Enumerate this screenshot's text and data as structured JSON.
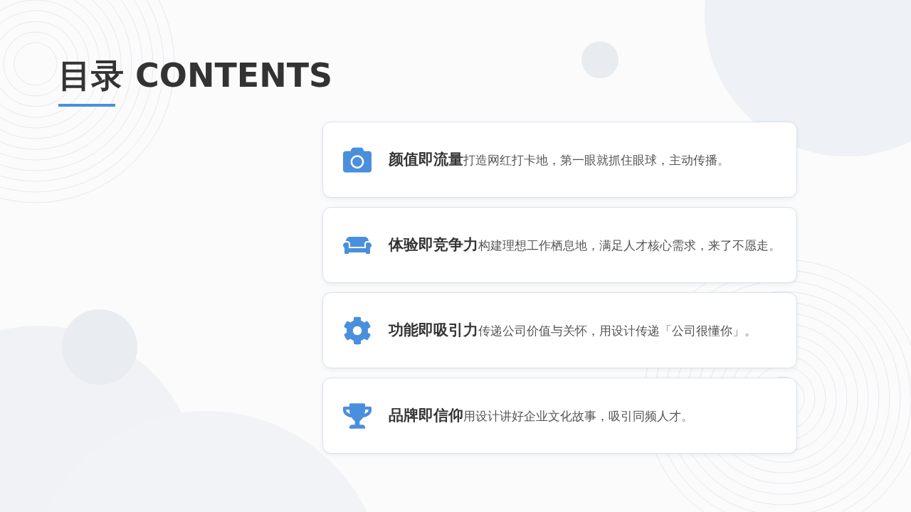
{
  "title": "目录 CONTENTS",
  "items": [
    {
      "kind": "camera",
      "text": "**颜值即流量**打造网红打卡地，第一眼就抓住眼球，主动传播。"
    },
    {
      "kind": "sofa",
      "text": "**体验即竞争力**构建理想工作栖息地，满足人才核心需求，来了不愿走。"
    },
    {
      "kind": "gear",
      "text": "**功能即吸引力**传递公司价值与关怀，用设计传递「公司很懂你」。"
    },
    {
      "kind": "trophy",
      "text": "**品牌即信仰**用设计讲好企业文化故事，吸引同频人才。"
    }
  ]
}
